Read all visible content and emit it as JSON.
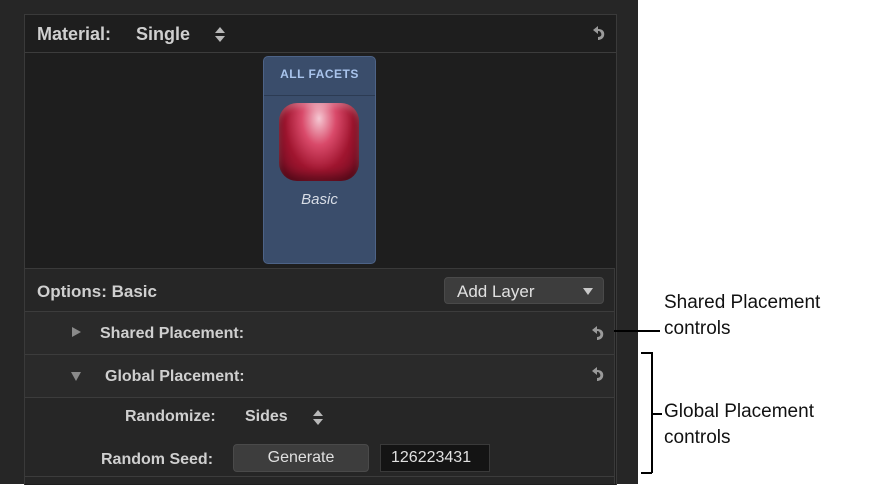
{
  "material": {
    "label": "Material:",
    "value": "Single"
  },
  "facets": {
    "title": "ALL FACETS",
    "swatch_label": "Basic"
  },
  "options": {
    "title": "Options: Basic",
    "add_layer": "Add Layer"
  },
  "shared_placement": {
    "label": "Shared Placement:"
  },
  "global_placement": {
    "label": "Global Placement:",
    "randomize_label": "Randomize:",
    "randomize_value": "Sides",
    "random_seed_label": "Random Seed:",
    "generate_button": "Generate",
    "seed_value": "126223431"
  },
  "callouts": {
    "shared_line1": "Shared Placement",
    "shared_line2": "controls",
    "global_line1": "Global Placement",
    "global_line2": "controls"
  },
  "icons": {
    "reset": "reset-arrow-icon",
    "disclosure": "disclosure-triangle-icon",
    "stepper": "up-down-stepper-icon",
    "dropdown": "chevron-down-icon"
  }
}
